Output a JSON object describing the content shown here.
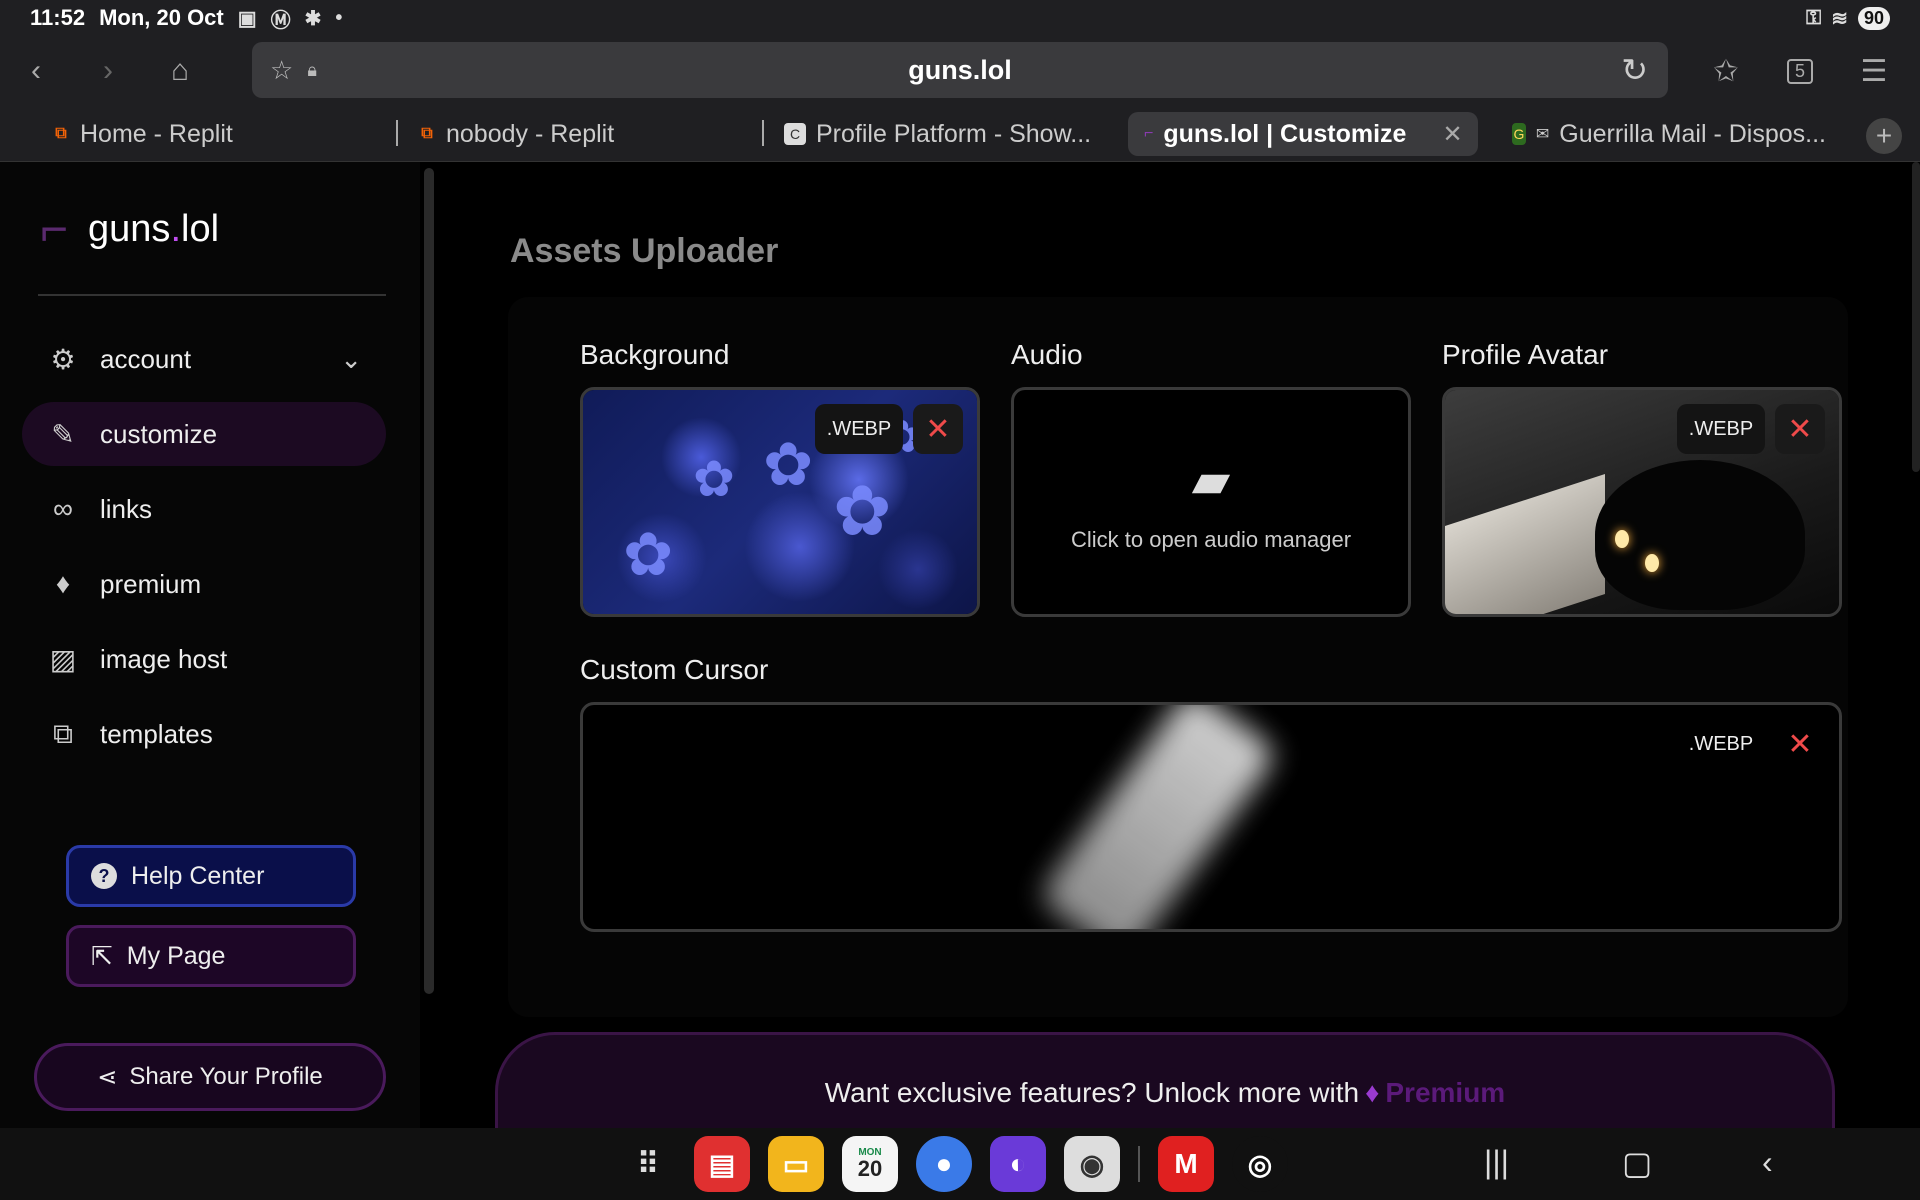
{
  "status": {
    "time": "11:52",
    "date": "Mon, 20 Oct",
    "battery": "90"
  },
  "browser": {
    "url": "guns.lol",
    "tab_count": "5"
  },
  "tabs": [
    {
      "title": "Home - Replit"
    },
    {
      "title": "nobody - Replit"
    },
    {
      "title": "Profile Platform - Show..."
    },
    {
      "title": "guns.lol | Customize"
    },
    {
      "title": "Guerrilla Mail - Dispos..."
    }
  ],
  "sidebar": {
    "logo_prefix": "guns",
    "logo_dot": ".",
    "logo_suffix": "lol",
    "items": [
      {
        "label": "account"
      },
      {
        "label": "customize"
      },
      {
        "label": "links"
      },
      {
        "label": "premium"
      },
      {
        "label": "image host"
      },
      {
        "label": "templates"
      }
    ],
    "help_label": "Help Center",
    "mypage_label": "My Page",
    "share_label": "Share Your Profile"
  },
  "main": {
    "title": "Assets Uploader",
    "background": {
      "label": "Background",
      "format": ".WEBP"
    },
    "audio": {
      "label": "Audio",
      "hint": "Click to open audio manager"
    },
    "avatar": {
      "label": "Profile Avatar",
      "format": ".WEBP"
    },
    "cursor": {
      "label": "Custom Cursor",
      "format": ".WEBP"
    },
    "premium_text": "Want exclusive features? Unlock more with",
    "premium_link": "Premium"
  },
  "dock": {
    "calendar_day": "20",
    "calendar_month": "MON"
  },
  "colors": {
    "accent": "#c04df0",
    "danger": "#ef4a4a",
    "help_bg": "#0a0f4a"
  }
}
